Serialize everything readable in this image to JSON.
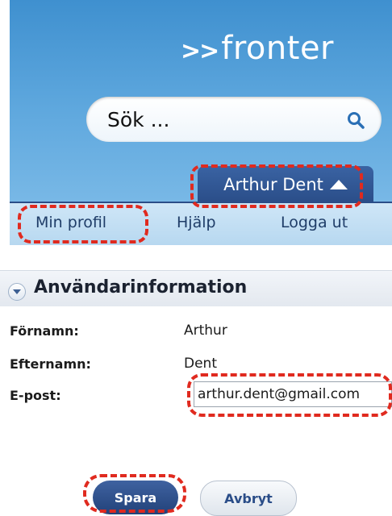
{
  "header": {
    "logo_arrows": ">>",
    "logo_text": "fronter",
    "search_placeholder": "Sök ...",
    "user_name": "Arthur Dent"
  },
  "nav": {
    "items": [
      {
        "label": "Min profil"
      },
      {
        "label": "Hjälp"
      },
      {
        "label": "Logga ut"
      }
    ]
  },
  "section": {
    "title": "Användarinformation"
  },
  "fields": {
    "first_name_label": "Förnamn:",
    "first_name_value": "Arthur",
    "last_name_label": "Efternamn:",
    "last_name_value": "Dent",
    "email_label": "E-post:",
    "email_value": "arthur.dent@gmail.com"
  },
  "buttons": {
    "save": "Spara",
    "cancel": "Avbryt"
  },
  "colors": {
    "header_blue": "#4a9ad6",
    "tab_navy": "#2a4d88",
    "annotation_red": "#e02a1f"
  }
}
